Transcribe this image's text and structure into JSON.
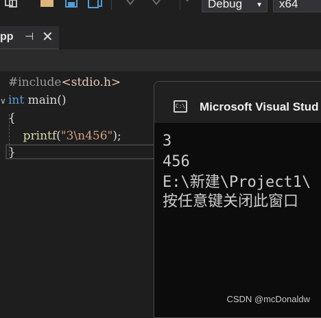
{
  "toolbar": {
    "config_dropdown": "Debug",
    "platform_dropdown": "x64"
  },
  "tab": {
    "name": "pp",
    "pin_glyph": "⊣",
    "close_glyph": "✕"
  },
  "code": {
    "line1_directive": "#include",
    "line1_header": "<stdio.h>",
    "line2_keyword": "int",
    "line2_rest": " main()",
    "line3": "{",
    "line4_indent": "    ",
    "line4_fn": "printf",
    "line4_open": "(",
    "line4_str": "\"3\\n456\"",
    "line4_close": ");",
    "line5": "}"
  },
  "console": {
    "title": "Microsoft Visual Stud",
    "icon_text": "C:\\",
    "output_lines": [
      "3",
      "456",
      "E:\\新建\\Project1\\",
      "按任意键关闭此窗口"
    ]
  },
  "watermark": "CSDN @mcDonaldw",
  "colors": {
    "editor_bg": "#1e1e1e",
    "keyword": "#569cd6",
    "function": "#dcdcaa",
    "string": "#d69d85",
    "console_bg": "#0c0c0c"
  }
}
